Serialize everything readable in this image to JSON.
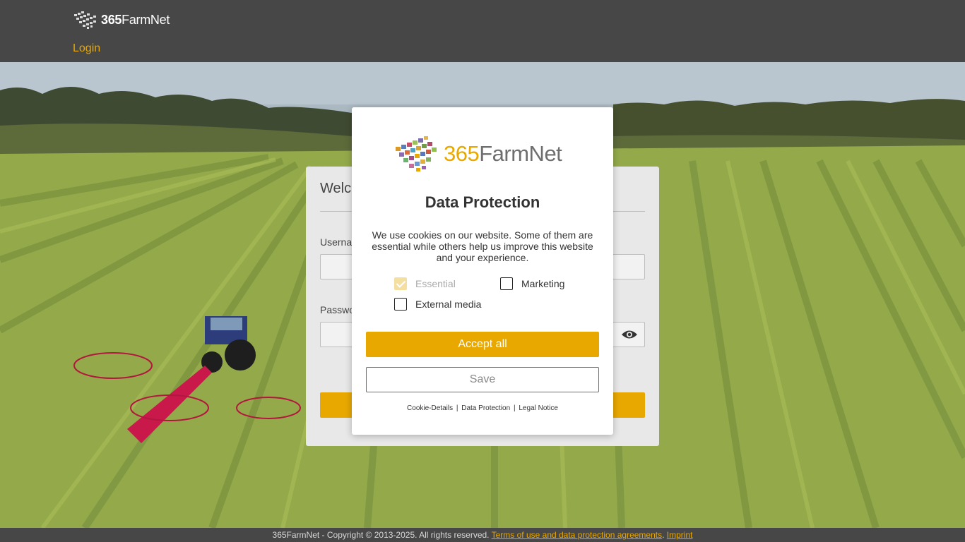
{
  "header": {
    "logo_text_bold": "365",
    "logo_text": "FarmNet",
    "login_link": "Login"
  },
  "login_card": {
    "title": "Welc",
    "username_label": "Userna",
    "password_label": "Passwo",
    "eye_icon": "eye-icon"
  },
  "modal": {
    "logo_number": "365",
    "logo_word": "FarmNet",
    "title": "Data Protection",
    "text": "We use cookies on our website. Some of them are essential while others help us improve this website and your experience.",
    "checkboxes": [
      {
        "label": "Essential",
        "checked": true,
        "disabled": true
      },
      {
        "label": "Marketing",
        "checked": false,
        "disabled": false
      },
      {
        "label": "External media",
        "checked": false,
        "disabled": false
      }
    ],
    "accept_all_label": "Accept all",
    "save_label": "Save",
    "links": [
      "Cookie-Details",
      "Data Protection",
      "Legal Notice"
    ],
    "link_separator": "|"
  },
  "footer": {
    "copyright": "365FarmNet - Copyright © 2013-2025. All rights reserved.",
    "terms_link": "Terms of use and data protection agreements",
    "dot": ".",
    "imprint_link": "Imprint"
  },
  "colors": {
    "accent": "#e8a800",
    "header_bg": "#474747",
    "modal_bg": "#ffffff"
  }
}
